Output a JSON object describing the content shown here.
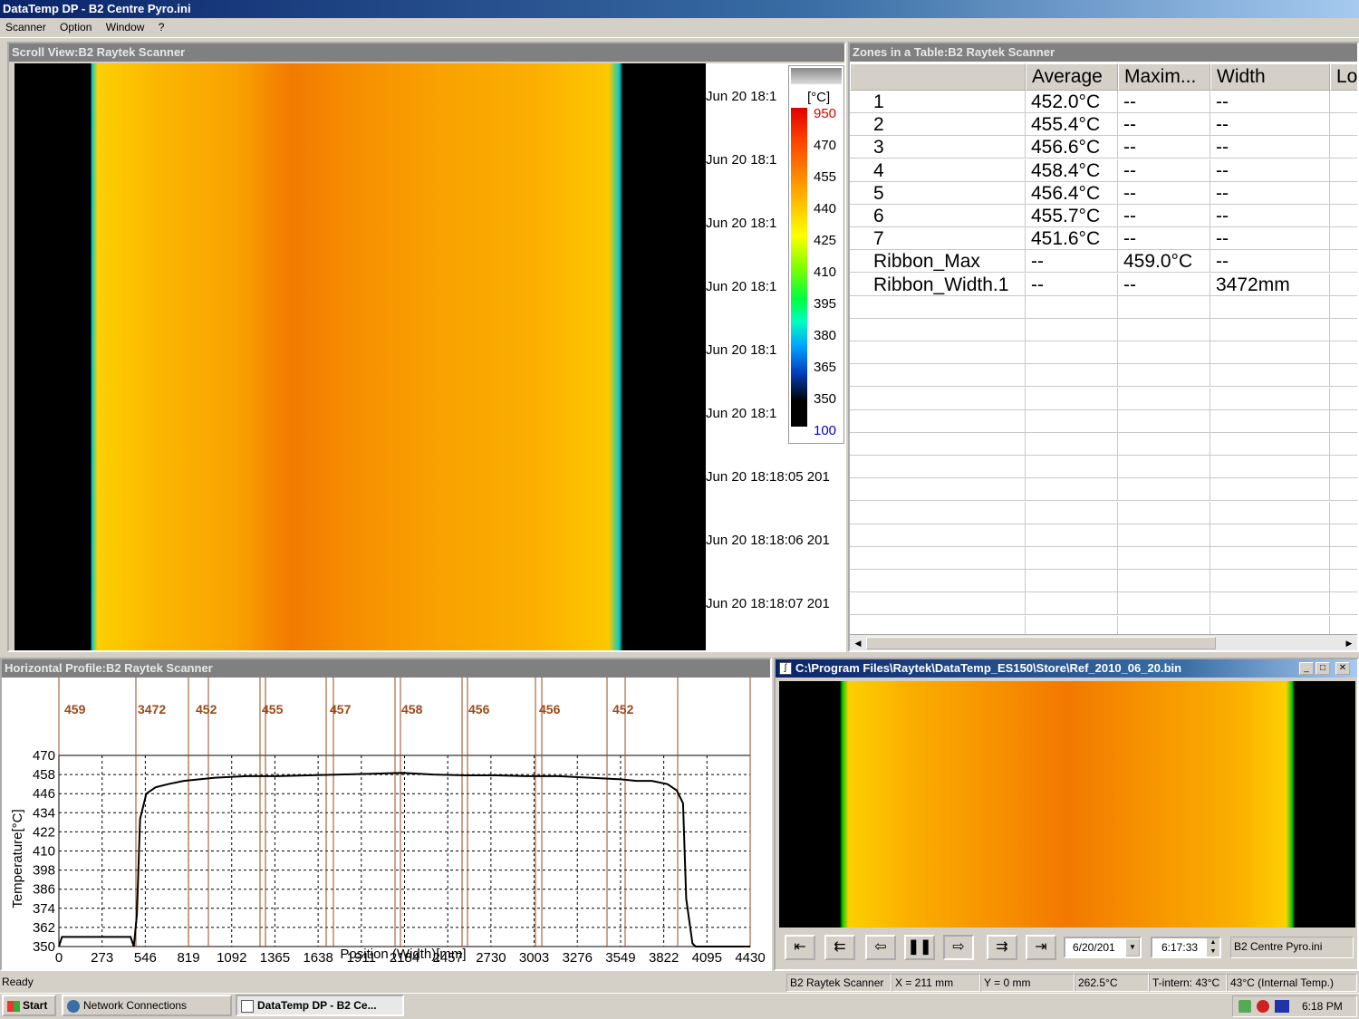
{
  "window": {
    "title": "DataTemp DP - B2 Centre Pyro.ini"
  },
  "menu": [
    "Scanner",
    "Option",
    "Window",
    "?"
  ],
  "scroll_view": {
    "title": "Scroll View:B2 Raytek Scanner",
    "timestamps": [
      "Jun 20 18:1",
      "Jun 20 18:1",
      "Jun 20 18:1",
      "Jun 20 18:1",
      "Jun 20 18:1",
      "Jun 20 18:1",
      "Jun 20 18:18:05 201",
      "Jun 20 18:18:06 201",
      "Jun 20 18:18:07 201"
    ],
    "scale": {
      "unit": "[°C]",
      "max": "950",
      "min": "100",
      "ticks": [
        "470",
        "455",
        "440",
        "425",
        "410",
        "395",
        "380",
        "365",
        "350"
      ]
    }
  },
  "zones_table": {
    "title": "Zones in a Table:B2 Raytek Scanner",
    "columns": [
      "",
      "Average",
      "Maxim...",
      "Width",
      "Lo"
    ],
    "rows": [
      [
        "1",
        "452.0°C",
        "--",
        "--"
      ],
      [
        "2",
        "455.4°C",
        "--",
        "--"
      ],
      [
        "3",
        "456.6°C",
        "--",
        "--"
      ],
      [
        "4",
        "458.4°C",
        "--",
        "--"
      ],
      [
        "5",
        "456.4°C",
        "--",
        "--"
      ],
      [
        "6",
        "455.7°C",
        "--",
        "--"
      ],
      [
        "7",
        "451.6°C",
        "--",
        "--"
      ],
      [
        "Ribbon_Max",
        "--",
        "459.0°C",
        "--"
      ],
      [
        "Ribbon_Width.1",
        "--",
        "--",
        "3472mm"
      ]
    ]
  },
  "profile": {
    "title": "Horizontal Profile:B2 Raytek Scanner",
    "zone_labels": [
      "459",
      "3472",
      "452",
      "455",
      "457",
      "458",
      "456",
      "456",
      "452"
    ],
    "y_ticks": [
      "470",
      "458",
      "446",
      "434",
      "422",
      "410",
      "398",
      "386",
      "374",
      "362",
      "350"
    ],
    "x_ticks": [
      "0",
      "273",
      "546",
      "819",
      "1092",
      "1365",
      "1638",
      "1911",
      "2184",
      "2457",
      "2730",
      "3003",
      "3276",
      "3549",
      "3822",
      "4095",
      "4430"
    ],
    "ylabel": "Temperature[°C]",
    "xlabel": "Position (Width)[mm]"
  },
  "chart_data": {
    "type": "line",
    "xlabel": "Position (Width)[mm]",
    "ylabel": "Temperature[°C]",
    "xlim": [
      0,
      4430
    ],
    "ylim": [
      350,
      470
    ],
    "series": [
      {
        "x": [
          0,
          20,
          460,
          480,
          500,
          520,
          560,
          620,
          700,
          800,
          900,
          1000,
          1200,
          1400,
          1600,
          1800,
          2000,
          2200,
          2400,
          2600,
          2800,
          3000,
          3200,
          3400,
          3600,
          3700,
          3800,
          3900,
          3960,
          4000,
          4020,
          4060,
          4080,
          4430
        ],
        "y": [
          350,
          356,
          356,
          350,
          370,
          430,
          446,
          450,
          452,
          454,
          455,
          456,
          457,
          457,
          457.5,
          458,
          458.5,
          459,
          458,
          457.5,
          457.5,
          457,
          457,
          456,
          455,
          454,
          454,
          452,
          448,
          440,
          380,
          352,
          350,
          350
        ]
      }
    ]
  },
  "playback": {
    "title": "C:\\Program Files\\Raytek\\DataTemp_ES150\\Store\\Ref_2010_06_20.bin",
    "date": "6/20/201",
    "time": "6:17:33",
    "config": "B2 Centre Pyro.ini",
    "buttons": [
      "first",
      "rewind",
      "step-back",
      "pause",
      "step-forward",
      "fast-forward",
      "last"
    ]
  },
  "status": {
    "ready": "Ready",
    "scanner": "B2 Raytek Scanner",
    "x": "X = 211 mm",
    "y": "Y = 0 mm",
    "temp": "262.5°C",
    "t_intern": "T-intern: 43°C",
    "internal": "43°C (Internal Temp.)"
  },
  "taskbar": {
    "start": "Start",
    "items": [
      "Network Connections",
      "DataTemp DP - B2 Ce..."
    ],
    "clock": "6:18 PM"
  }
}
